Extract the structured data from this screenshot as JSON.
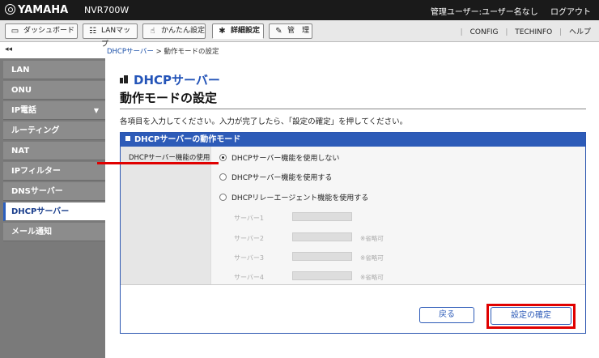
{
  "topbar": {
    "logo": "YAMAHA",
    "model": "NVR700W",
    "user": "管理ユーザー:ユーザー名なし",
    "logout": "ログアウト"
  },
  "tabs": [
    {
      "label": "ダッシュボード",
      "icon": "dashboard-icon"
    },
    {
      "label": "LANマップ",
      "icon": "lan-map-icon"
    },
    {
      "label": "かんたん設定",
      "icon": "wizard-icon"
    },
    {
      "label": "詳細設定",
      "icon": "gear-icon",
      "active": true
    },
    {
      "label": "管　理",
      "icon": "wrench-icon"
    }
  ],
  "sublinks": {
    "config": "CONFIG",
    "techinfo": "TECHINFO",
    "help": "ヘルプ"
  },
  "collapse_glyph": "◂◂",
  "sidebar": {
    "items": [
      {
        "label": "LAN"
      },
      {
        "label": "ONU"
      },
      {
        "label": "IP電話",
        "arrow": "▼"
      },
      {
        "label": "ルーティング"
      },
      {
        "label": "NAT"
      },
      {
        "label": "IPフィルター"
      },
      {
        "label": "DNSサーバー"
      },
      {
        "label": "DHCPサーバー",
        "active": true
      },
      {
        "label": "メール通知"
      }
    ]
  },
  "breadcrumb": {
    "parent": "DHCPサーバー",
    "separator": " > ",
    "current": "動作モードの設定"
  },
  "header": {
    "section": "DHCPサーバー",
    "title": "動作モードの設定",
    "instruction": "各項目を入力してください。入力が完了したら、「設定の確定」を押してください。"
  },
  "panel": {
    "title": "DHCPサーバーの動作モード",
    "field_label": "DHCPサーバー機能の使用",
    "options": [
      {
        "label": "DHCPサーバー機能を使用しない",
        "checked": true
      },
      {
        "label": "DHCPサーバー機能を使用する",
        "checked": false
      },
      {
        "label": "DHCPリレーエージェント機能を使用する",
        "checked": false
      }
    ],
    "servers": [
      {
        "label": "サーバー1",
        "note": ""
      },
      {
        "label": "サーバー2",
        "note": "※省略可"
      },
      {
        "label": "サーバー3",
        "note": "※省略可"
      },
      {
        "label": "サーバー4",
        "note": "※省略可"
      }
    ]
  },
  "buttons": {
    "back": "戻る",
    "confirm": "設定の確定"
  },
  "colors": {
    "accent": "#2d5bb8",
    "highlight": "#e00000",
    "sidebar": "#7a7a7a"
  }
}
